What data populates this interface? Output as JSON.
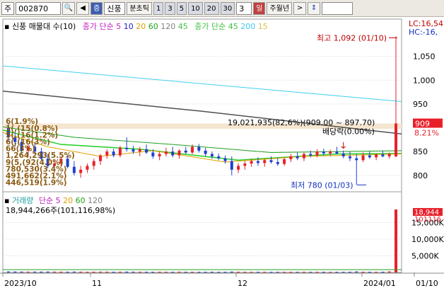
{
  "toolbar": {
    "market_label": "주",
    "stock_code": "002870",
    "stock_name": "신풍",
    "mode_label": "증",
    "tick_label": "분초틱",
    "periods": [
      "1",
      "3",
      "5",
      "10",
      "20",
      "30"
    ],
    "period_value": "3",
    "selected_label": "일",
    "week_month_year": "주월년"
  },
  "price_panel": {
    "legend": {
      "name": "신풍 매물대 수(10)",
      "ma_label": "종가 단순",
      "ma_values": [
        "5",
        "10",
        "20",
        "60",
        "120",
        "45"
      ],
      "ma2_label": "종가 단순",
      "ma2_values": [
        "45",
        "200",
        "15"
      ]
    },
    "lc": "LC:16,54",
    "hc": "HC:-16,",
    "y_ticks": [
      "1,050",
      "1,000",
      "950",
      "850",
      "800"
    ],
    "high_label": "최고 1,092 (01/10)",
    "low_label": "최저 780 (01/03)",
    "volume_profile_label": "19,021,935(82,6%)(909.00 ~ 897.70)",
    "dividend_label": "배당락(0.00%)",
    "current_price": "909",
    "current_change": "8.21%",
    "profile_labels": [
      "6(1.9%)",
      "1(,(15(0.8%)",
      "5(,(16(1.2%)",
      "6(,(16(3%)",
      "66(3%)",
      "1,264,293(5.5%)",
      "9(5,(92(4.0%)",
      "780,530(3.4%)",
      "491,662(2.1%)",
      "446,519(1.9%)"
    ]
  },
  "volume_panel": {
    "legend": {
      "name": "거래량",
      "ma_label": "단순",
      "ma_values": [
        "5",
        "20",
        "60",
        "120"
      ]
    },
    "volume_text": "18,944,266주(101,116,98%)",
    "y_ticks": [
      "15,000K",
      "10,000K",
      "5,000K"
    ],
    "current_volume": "18,944",
    "current_volume_2": "101116"
  },
  "x_axis": {
    "labels": [
      "2023/10",
      "11",
      "12",
      "2024/01",
      "01/10"
    ]
  },
  "colors": {
    "up": "#e8202a",
    "down": "#1e40d0",
    "ma5": "#c020c0",
    "ma10": "#2020c0",
    "ma20": "#e0a000",
    "ma60": "#20a020",
    "ma120": "#808080",
    "ma45": "#40e040",
    "ma200": "#40d0f0",
    "ma15": "#e0c040"
  },
  "chart_data": {
    "type": "candlestick",
    "y_range": [
      770,
      1100
    ],
    "volume_range": [
      0,
      20000
    ],
    "candles": [
      [
        900,
        908,
        870,
        880
      ],
      [
        880,
        892,
        860,
        870
      ],
      [
        870,
        876,
        845,
        852
      ],
      [
        852,
        865,
        840,
        860
      ],
      [
        860,
        870,
        845,
        850
      ],
      [
        850,
        858,
        830,
        835
      ],
      [
        835,
        845,
        815,
        820
      ],
      [
        820,
        832,
        805,
        825
      ],
      [
        825,
        840,
        818,
        835
      ],
      [
        835,
        842,
        815,
        818
      ],
      [
        818,
        830,
        800,
        805
      ],
      [
        805,
        820,
        795,
        812
      ],
      [
        812,
        825,
        805,
        820
      ],
      [
        820,
        835,
        812,
        830
      ],
      [
        830,
        845,
        822,
        842
      ],
      [
        842,
        855,
        835,
        850
      ],
      [
        850,
        856,
        838,
        842
      ],
      [
        842,
        862,
        838,
        858
      ],
      [
        858,
        880,
        850,
        855
      ],
      [
        855,
        862,
        845,
        850
      ],
      [
        850,
        860,
        840,
        855
      ],
      [
        855,
        865,
        845,
        848
      ],
      [
        848,
        855,
        835,
        840
      ],
      [
        840,
        850,
        832,
        845
      ],
      [
        845,
        858,
        840,
        850
      ],
      [
        850,
        860,
        838,
        842
      ],
      [
        842,
        855,
        835,
        852
      ],
      [
        852,
        860,
        845,
        848
      ],
      [
        848,
        865,
        845,
        860
      ],
      [
        860,
        866,
        848,
        852
      ],
      [
        852,
        858,
        840,
        845
      ],
      [
        845,
        850,
        835,
        840
      ],
      [
        840,
        846,
        832,
        836
      ],
      [
        836,
        842,
        825,
        830
      ],
      [
        830,
        840,
        800,
        812
      ],
      [
        812,
        826,
        805,
        820
      ],
      [
        820,
        830,
        812,
        825
      ],
      [
        825,
        835,
        818,
        830
      ],
      [
        830,
        838,
        820,
        826
      ],
      [
        826,
        835,
        818,
        832
      ],
      [
        832,
        840,
        825,
        828
      ],
      [
        828,
        836,
        820,
        824
      ],
      [
        824,
        838,
        820,
        834
      ],
      [
        834,
        845,
        828,
        840
      ],
      [
        840,
        848,
        832,
        836
      ],
      [
        836,
        848,
        830,
        845
      ],
      [
        845,
        852,
        838,
        842
      ],
      [
        842,
        855,
        838,
        850
      ],
      [
        850,
        856,
        842,
        846
      ],
      [
        846,
        854,
        840,
        850
      ],
      [
        850,
        860,
        844,
        846
      ],
      [
        846,
        852,
        836,
        840
      ],
      [
        840,
        850,
        830,
        836
      ],
      [
        836,
        845,
        780,
        832
      ],
      [
        832,
        848,
        828,
        842
      ],
      [
        842,
        850,
        835,
        838
      ],
      [
        838,
        846,
        832,
        844
      ],
      [
        844,
        852,
        838,
        840
      ],
      [
        840,
        848,
        835,
        845
      ],
      [
        840,
        1092,
        838,
        909
      ]
    ],
    "volumes": [
      300,
      280,
      260,
      240,
      250,
      260,
      270,
      250,
      240,
      230,
      260,
      240,
      220,
      230,
      250,
      240,
      220,
      230,
      260,
      240,
      230,
      220,
      210,
      230,
      220,
      210,
      240,
      220,
      210,
      200,
      210,
      220,
      200,
      210,
      260,
      230,
      210,
      200,
      210,
      200,
      190,
      200,
      210,
      220,
      200,
      210,
      200,
      220,
      210,
      200,
      210,
      200,
      220,
      300,
      230,
      210,
      200,
      220,
      300,
      18944
    ]
  }
}
